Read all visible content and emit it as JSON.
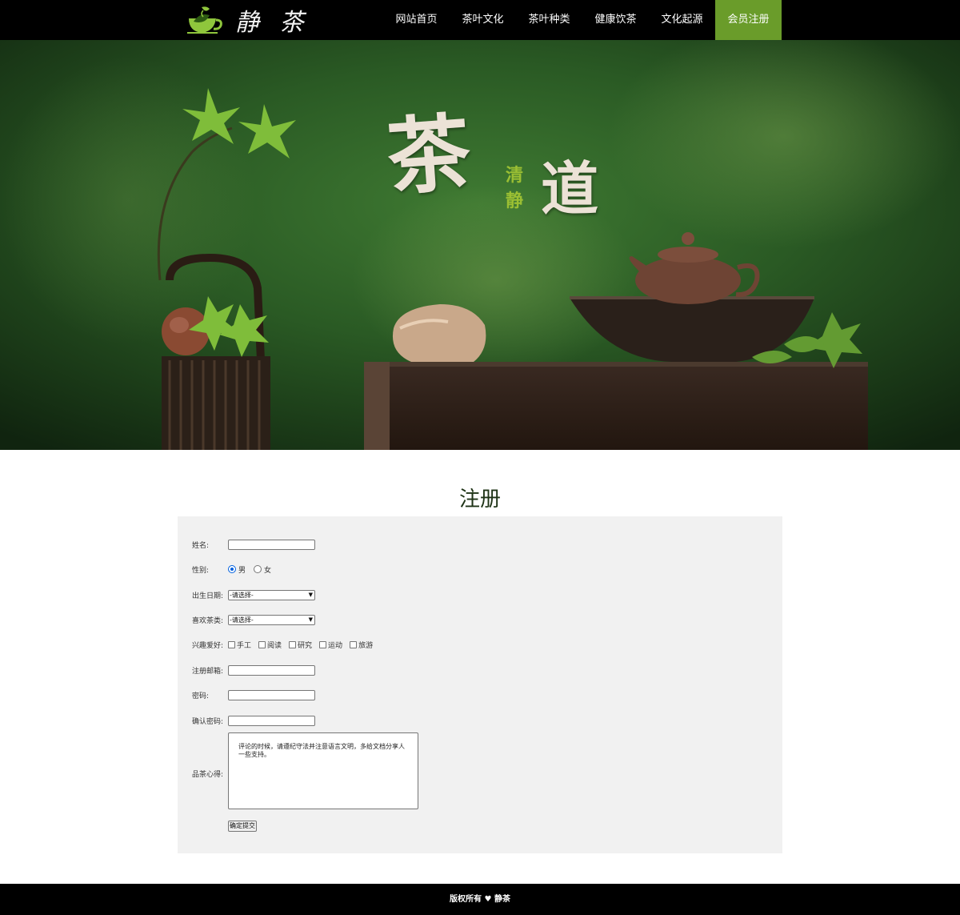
{
  "header": {
    "logo_text": "静 茶",
    "nav": [
      {
        "label": "网站首页"
      },
      {
        "label": "茶叶文化"
      },
      {
        "label": "茶叶种类"
      },
      {
        "label": "健康饮茶"
      },
      {
        "label": "文化起源"
      },
      {
        "label": "会员注册",
        "active": true
      }
    ]
  },
  "banner": {
    "big1": "茶",
    "small1": "清",
    "small2": "静",
    "big2": "道"
  },
  "register": {
    "title": "注册",
    "name_label": "姓名:",
    "gender_label": "性别:",
    "gender_male": "男",
    "gender_female": "女",
    "birth_label": "出生日期:",
    "birth_value": "-请选择-",
    "tea_label": "喜欢茶类:",
    "tea_value": "-请选择-",
    "hobby_label": "兴趣爱好:",
    "hobbies": [
      "手工",
      "阅读",
      "研究",
      "运动",
      "旅游"
    ],
    "email_label": "注册邮箱:",
    "password_label": "密码:",
    "confirm_label": "确认密码:",
    "notes_label": "品茶心得:",
    "notes_placeholder": "评论的时候，请遵纪守法并注意语言文明，多给文档分享人一些支持。",
    "submit_label": "确定提交"
  },
  "footer": {
    "text": "版权所有 ♥ 静茶"
  },
  "colors": {
    "accent": "#6a9c2a",
    "header_bg": "#000000",
    "panel_bg": "#f1f1f1"
  }
}
